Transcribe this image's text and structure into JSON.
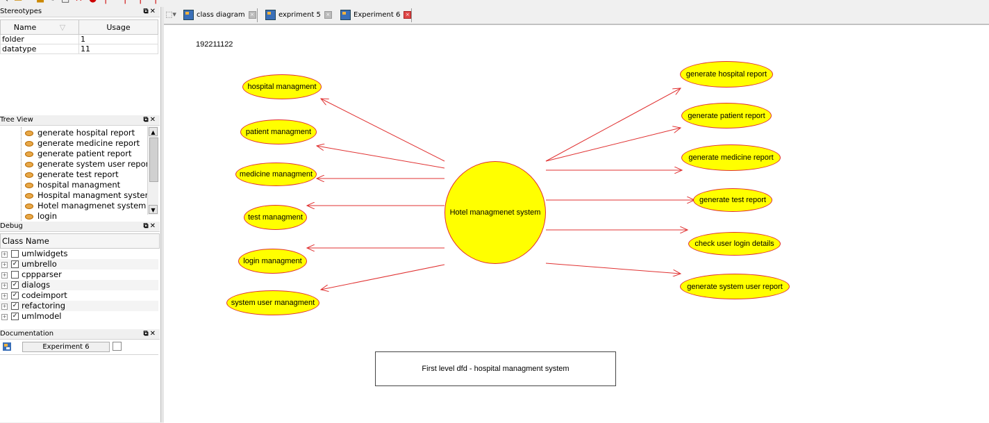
{
  "docks": {
    "stereotypes": {
      "title": "Stereotypes",
      "columns": [
        "Name",
        "Usage"
      ],
      "rows": [
        {
          "name": "folder",
          "usage": "1"
        },
        {
          "name": "datatype",
          "usage": "11"
        }
      ]
    },
    "tree_view": {
      "title": "Tree View",
      "items": [
        "generate hospital report",
        "generate medicine report",
        "generate patient report",
        "generate system user report",
        "generate test report",
        "hospital managment",
        "Hospital managment system",
        "Hotel managmenet system",
        "login"
      ]
    },
    "debug": {
      "title": "Debug",
      "column": "Class Name",
      "items": [
        {
          "label": "umlwidgets",
          "checked": false,
          "glyph": ""
        },
        {
          "label": "umbrello",
          "checked": true,
          "glyph": "✓"
        },
        {
          "label": "cppparser",
          "checked": false,
          "glyph": ""
        },
        {
          "label": "dialogs",
          "checked": true,
          "glyph": "✓"
        },
        {
          "label": "codeimport",
          "checked": true,
          "glyph": "✓"
        },
        {
          "label": "refactoring",
          "checked": true,
          "glyph": "✓"
        },
        {
          "label": "umlmodel",
          "checked": true,
          "glyph": "✓"
        }
      ]
    },
    "documentation": {
      "title": "Documentation",
      "button_label": "Experiment 6"
    }
  },
  "tabs": [
    {
      "label": "class diagram",
      "active": false
    },
    {
      "label": "expriment 5",
      "active": false
    },
    {
      "label": "Experiment 6",
      "active": true
    }
  ],
  "diagram": {
    "id_text": "192211122",
    "center": "Hotel managmenet system",
    "left_usecases": [
      "hospital managment",
      "patient managment",
      "medicine managment",
      "test managment",
      "login managment",
      "system user managment"
    ],
    "right_usecases": [
      "generate hospital report",
      "generate patient report",
      "generate medicine report",
      "generate test report",
      "check user login details",
      "generate system user report"
    ],
    "note": "First level dfd - hospital managment system"
  },
  "colors": {
    "usecase_fill": "#ffff00",
    "usecase_border": "#e03030",
    "arrow": "#e03030"
  }
}
